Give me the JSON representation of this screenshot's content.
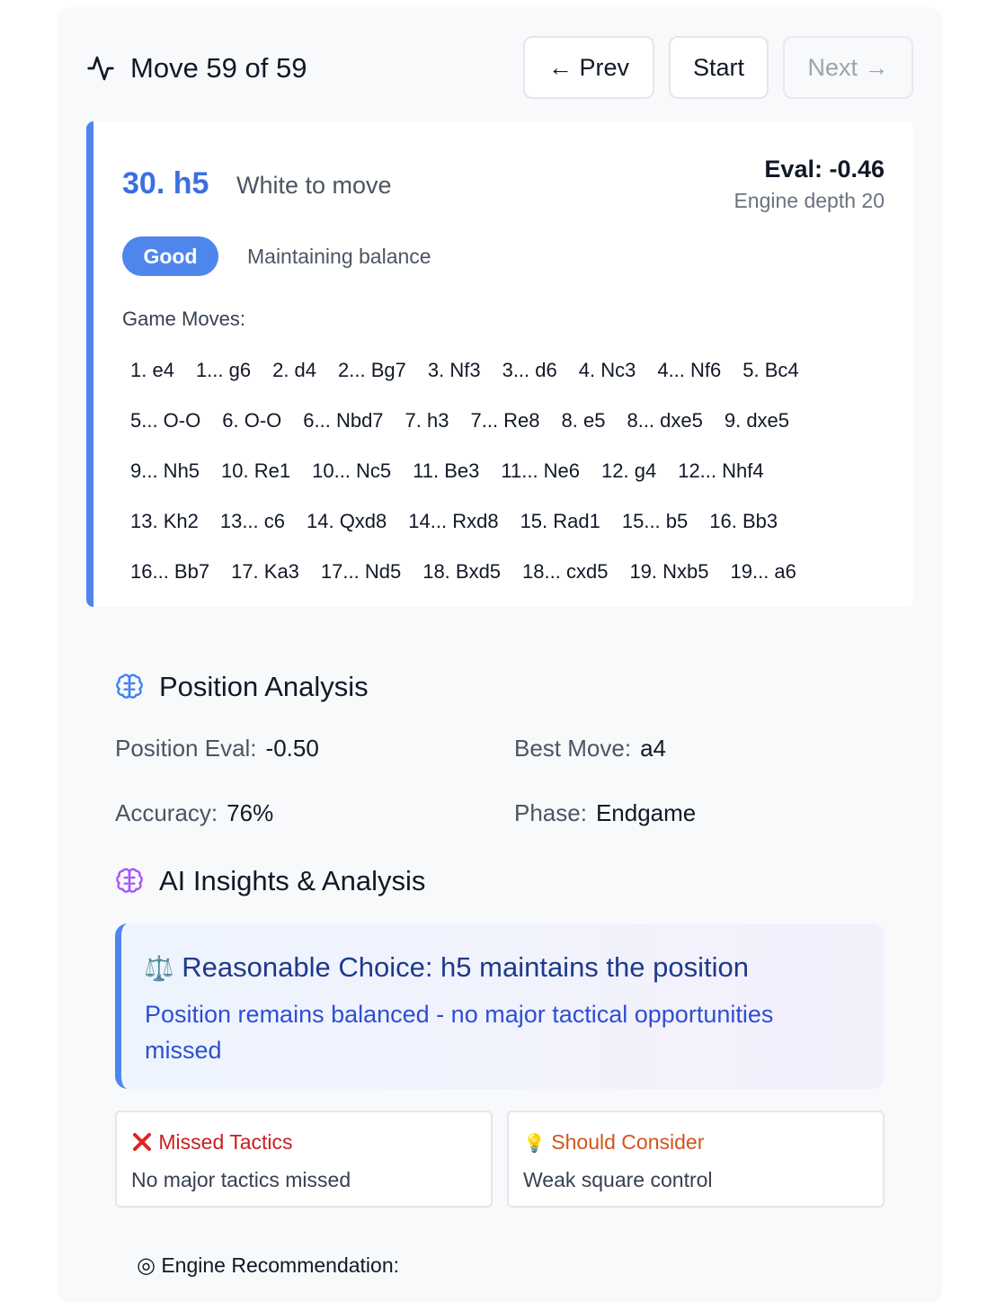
{
  "header": {
    "title": "Move 59 of 59",
    "prev_label": "← Prev",
    "start_label": "Start",
    "next_label": "Next →"
  },
  "move": {
    "san": "30. h5",
    "to_move": "White to move",
    "eval": "Eval: -0.46",
    "depth": "Engine depth 20",
    "quality": "Good",
    "quality_desc": "Maintaining balance",
    "quality_color": "#4f86ec",
    "moves_label": "Game Moves:",
    "move_rows": [
      [
        "1. e4",
        "1... g6",
        "2. d4",
        "2... Bg7",
        "3. Nf3",
        "3... d6",
        "4. Nc3",
        "4... Nf6",
        "5. Bc4"
      ],
      [
        "5... O-O",
        "6. O-O",
        "6... Nbd7",
        "7. h3",
        "7... Re8",
        "8. e5",
        "8... dxe5",
        "9. dxe5"
      ],
      [
        "9... Nh5",
        "10. Re1",
        "10... Nc5",
        "11. Be3",
        "11... Ne6",
        "12. g4",
        "12... Nhf4"
      ],
      [
        "13. Kh2",
        "13... c6",
        "14. Qxd8",
        "14... Rxd8",
        "15. Rad1",
        "15... b5",
        "16. Bb3"
      ],
      [
        "16... Bb7",
        "17. Ka3",
        "17... Nd5",
        "18. Bxd5",
        "18... cxd5",
        "19. Nxb5",
        "19... a6"
      ]
    ]
  },
  "position_analysis": {
    "title": "Position Analysis",
    "eval_label": "Position Eval:",
    "eval_value": "-0.50",
    "best_label": "Best Move:",
    "best_value": "a4",
    "accuracy_label": "Accuracy:",
    "accuracy_value": "76%",
    "phase_label": "Phase:",
    "phase_value": "Endgame"
  },
  "ai_insights": {
    "title": "AI Insights & Analysis",
    "headline_icon": "⚖️",
    "headline": "Reasonable Choice: h5 maintains the position",
    "body": "Position remains balanced - no major tactical opportunities missed",
    "missed_title": "Missed Tactics",
    "missed_body": "No major tactics missed",
    "missed_color": "#c81e1e",
    "consider_icon": "💡",
    "consider_title": "Should Consider",
    "consider_body": "Weak square control",
    "consider_color": "#d2541c",
    "engine_rec_icon": "◎",
    "engine_rec_label": "Engine Recommendation:"
  }
}
